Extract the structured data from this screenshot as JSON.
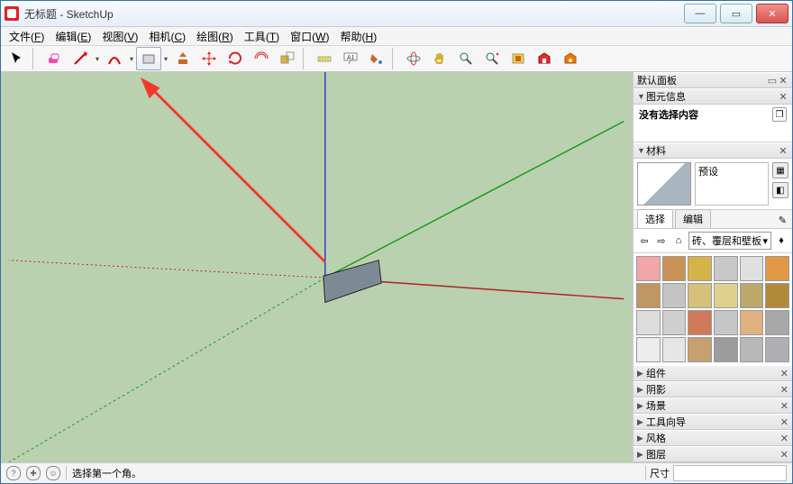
{
  "titlebar": {
    "title": "无标题 - SketchUp"
  },
  "window_buttons": {
    "min": "—",
    "max": "▭",
    "close": "✕"
  },
  "menu": [
    {
      "label": "文件",
      "accel": "F"
    },
    {
      "label": "编辑",
      "accel": "E"
    },
    {
      "label": "视图",
      "accel": "V"
    },
    {
      "label": "相机",
      "accel": "C"
    },
    {
      "label": "绘图",
      "accel": "R"
    },
    {
      "label": "工具",
      "accel": "T"
    },
    {
      "label": "窗口",
      "accel": "W"
    },
    {
      "label": "帮助",
      "accel": "H"
    }
  ],
  "toolbar": {
    "items": [
      "select",
      "eraser",
      "line",
      "arc",
      "shapes",
      "rect",
      "pushpull",
      "move",
      "rotate",
      "offset",
      "scale",
      "tape",
      "text",
      "paint",
      "sep",
      "orbit",
      "pan",
      "zoom",
      "zoom-extents",
      "prev",
      "warehouse",
      "ext-warehouse"
    ]
  },
  "side": {
    "default_panel_label": "默认面板",
    "entity_info": {
      "label": "图元信息",
      "status": "没有选择内容"
    },
    "materials": {
      "label": "材料",
      "default_name": "预设",
      "tabs": {
        "select": "选择",
        "edit": "编辑"
      },
      "collection": "砖、覆层和壁板",
      "swatches": [
        "#f1a7a7",
        "#c99256",
        "#d6b24a",
        "#c8c8c8",
        "#e0e0e0",
        "#e09845",
        "#c09664",
        "#c4c4c4",
        "#d6c07a",
        "#e0d090",
        "#bda76a",
        "#b08a3a",
        "#dcdcdc",
        "#cfcfcf",
        "#d07a5a",
        "#c6c6c6",
        "#e0b080",
        "#a8a8a8",
        "#ececec",
        "#e6e6e6",
        "#c7a070",
        "#9c9c9c",
        "#b8b8b8",
        "#aeb0b4"
      ]
    },
    "collapsed_panels": [
      "组件",
      "阴影",
      "场景",
      "工具向导",
      "风格",
      "图层"
    ]
  },
  "status": {
    "hint": "选择第一个角。",
    "dim_label": "尺寸"
  }
}
